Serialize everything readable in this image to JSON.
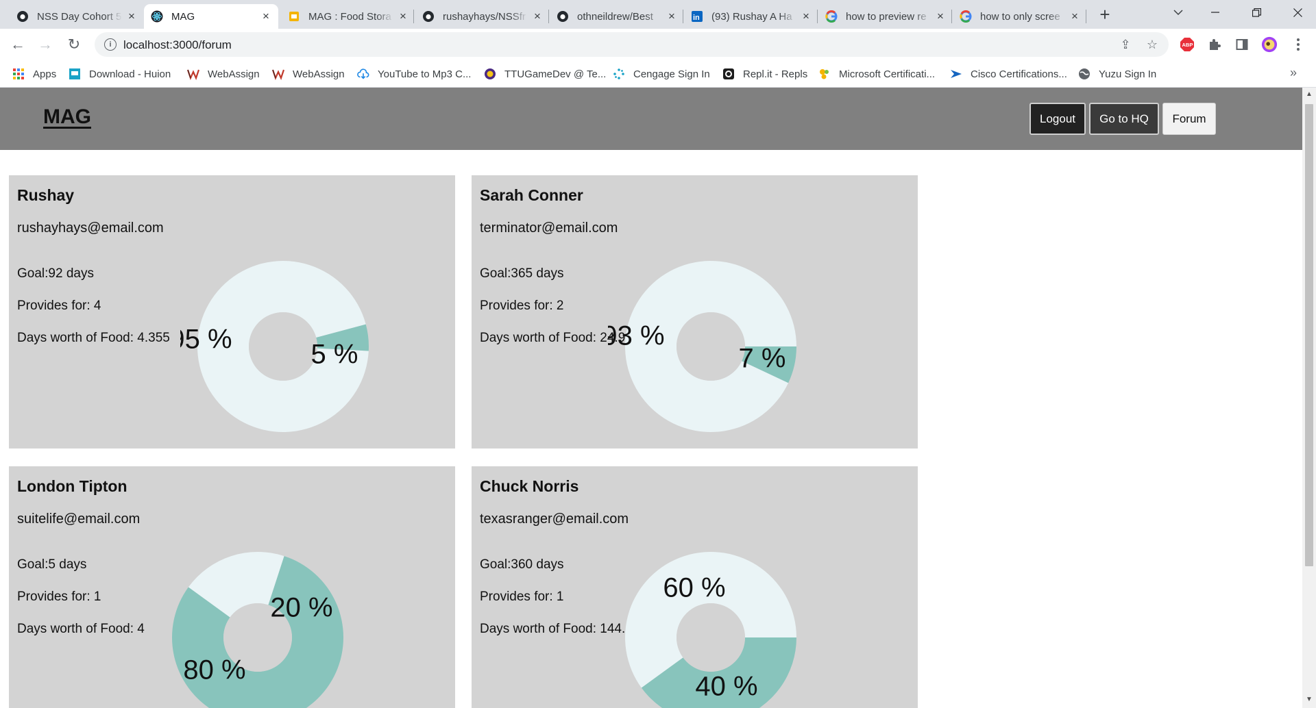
{
  "browser": {
    "tabs": [
      {
        "title": "NSS Day Cohort 5",
        "icon": "github-icon"
      },
      {
        "title": "MAG",
        "icon": "react-icon"
      },
      {
        "title": "MAG : Food Stora",
        "icon": "slides-icon"
      },
      {
        "title": "rushayhays/NSSfr",
        "icon": "github-icon"
      },
      {
        "title": "othneildrew/Best",
        "icon": "github-icon"
      },
      {
        "title": "(93) Rushay A Ha",
        "icon": "linkedin-icon"
      },
      {
        "title": "how to preview re",
        "icon": "google-icon"
      },
      {
        "title": "how to only scree",
        "icon": "google-icon"
      }
    ],
    "url": "localhost:3000/forum",
    "bookmarks": [
      {
        "label": "Apps",
        "icon": "apps-grid-icon"
      },
      {
        "label": "Download - Huion",
        "icon": "huion-icon"
      },
      {
        "label": "WebAssign",
        "icon": "webassign-icon"
      },
      {
        "label": "WebAssign",
        "icon": "webassign-icon"
      },
      {
        "label": "YouTube to Mp3 C...",
        "icon": "cloud-download-icon"
      },
      {
        "label": "TTUGameDev @ Te...",
        "icon": "ttu-icon"
      },
      {
        "label": "Cengage Sign In",
        "icon": "cengage-icon"
      },
      {
        "label": "Repl.it - Repls",
        "icon": "replit-icon"
      },
      {
        "label": "Microsoft Certificati...",
        "icon": "microsoft-cert-icon"
      },
      {
        "label": "Cisco Certifications...",
        "icon": "cisco-icon"
      },
      {
        "label": "Yuzu Sign In",
        "icon": "globe-icon"
      }
    ]
  },
  "app": {
    "brand": "MAG",
    "nav": {
      "logout": "Logout",
      "hq": "Go to HQ",
      "forum": "Forum"
    }
  },
  "cards": [
    {
      "name": "Rushay",
      "email": "rushayhays@email.com",
      "goal": "Goal:92 days",
      "provides": "Provides for: 4",
      "days_worth": "Days worth of Food: 4.355",
      "label_remaining": "95 %",
      "label_stored": "5 %",
      "stored_fraction": 0.05
    },
    {
      "name": "Sarah Conner",
      "email": "terminator@email.com",
      "goal": "Goal:365 days",
      "provides": "Provides for: 2",
      "days_worth": "Days worth of Food: 24.93",
      "label_remaining": "93 %",
      "label_stored": "7 %",
      "stored_fraction": 0.07
    },
    {
      "name": "London Tipton",
      "email": "suitelife@email.com",
      "goal": "Goal:5 days",
      "provides": "Provides for: 1",
      "days_worth": "Days worth of Food: 4",
      "label_remaining": "20 %",
      "label_stored": "80 %",
      "stored_fraction": 0.8
    },
    {
      "name": "Chuck Norris",
      "email": "texasranger@email.com",
      "goal": "Goal:360 days",
      "provides": "Provides for: 1",
      "days_worth": "Days worth of Food: 144.4",
      "label_remaining": "60 %",
      "label_stored": "40 %",
      "stored_fraction": 0.4
    }
  ],
  "colors": {
    "stored": "#88c4bc",
    "remaining": "#eaf4f6",
    "hole": "#d3d3d3",
    "card": "#d3d3d3",
    "header": "#808080"
  }
}
